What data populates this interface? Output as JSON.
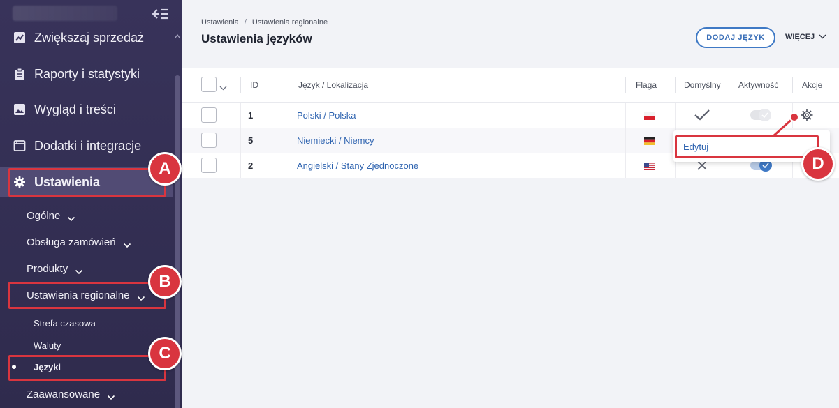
{
  "sidebar": {
    "nav": [
      {
        "label": "Zwiększaj sprzedaż",
        "icon": "trend-chart-icon"
      },
      {
        "label": "Raporty i statystyki",
        "icon": "clipboard-icon"
      },
      {
        "label": "Wygląd i treści",
        "icon": "image-icon"
      },
      {
        "label": "Dodatki i integracje",
        "icon": "window-icon"
      },
      {
        "label": "Ustawienia",
        "icon": "gear-icon"
      }
    ],
    "settings_sub": {
      "general": "Ogólne",
      "orders": "Obsługa zamówień",
      "products": "Produkty",
      "regional": "Ustawienia regionalne",
      "regional_items": {
        "timezone": "Strefa czasowa",
        "currencies": "Waluty",
        "languages": "Języki"
      },
      "advanced": "Zaawansowane"
    }
  },
  "header": {
    "breadcrumb": [
      "Ustawienia",
      "/",
      "Ustawienia regionalne"
    ],
    "title": "Ustawienia języków",
    "add_button": "DODAJ JĘZYK",
    "more_button": "WIĘCEJ"
  },
  "table": {
    "columns": {
      "id": "ID",
      "language": "Język / Lokalizacja",
      "flag": "Flaga",
      "default": "Domyślny",
      "active": "Aktywność",
      "actions": "Akcje"
    },
    "rows": [
      {
        "id": "1",
        "language": "Polski / Polska",
        "flag": "pl",
        "default": true,
        "active": false
      },
      {
        "id": "5",
        "language": "Niemiecki / Niemcy",
        "flag": "de",
        "default": false,
        "active": false
      },
      {
        "id": "2",
        "language": "Angielski / Stany Zjednoczone",
        "flag": "us",
        "default": false,
        "active": true
      }
    ]
  },
  "dropdown": {
    "edit": "Edytuj"
  },
  "annotations": {
    "a": "A",
    "b": "B",
    "c": "C",
    "d": "D"
  },
  "colors": {
    "accent": "#3f79c5",
    "highlight": "#d9353f",
    "sidebar": "#38335a"
  }
}
